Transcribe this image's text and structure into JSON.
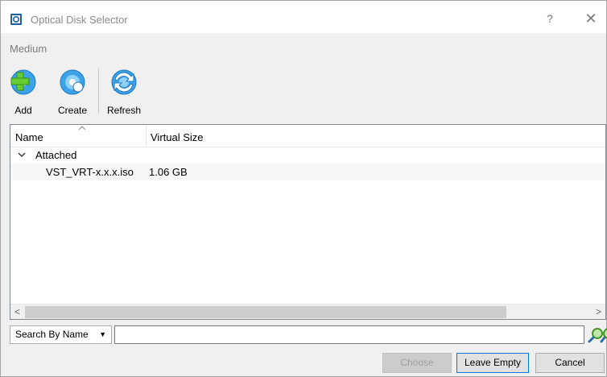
{
  "window": {
    "title": "Optical Disk Selector",
    "help": "?",
    "close": "✕"
  },
  "section_label": "Medium",
  "toolbar": {
    "add_label": "Add",
    "create_label": "Create",
    "refresh_label": "Refresh"
  },
  "table": {
    "columns": [
      "Name",
      "Virtual Size"
    ],
    "group": {
      "label": "Attached",
      "expanded": true
    },
    "rows": [
      {
        "name": "VST_VRT-x.x.x.iso",
        "size": "1.06 GB"
      }
    ]
  },
  "scrollbar": {
    "left_arrow": "<",
    "right_arrow": ">"
  },
  "search": {
    "mode": "Search By Name",
    "value": ""
  },
  "buttons": {
    "choose": "Choose",
    "leave_empty": "Leave Empty",
    "cancel": "Cancel"
  },
  "colors": {
    "accent": "#0078d7",
    "icon_fill": "#3da3e8",
    "icon_plus": "#66cc33"
  }
}
